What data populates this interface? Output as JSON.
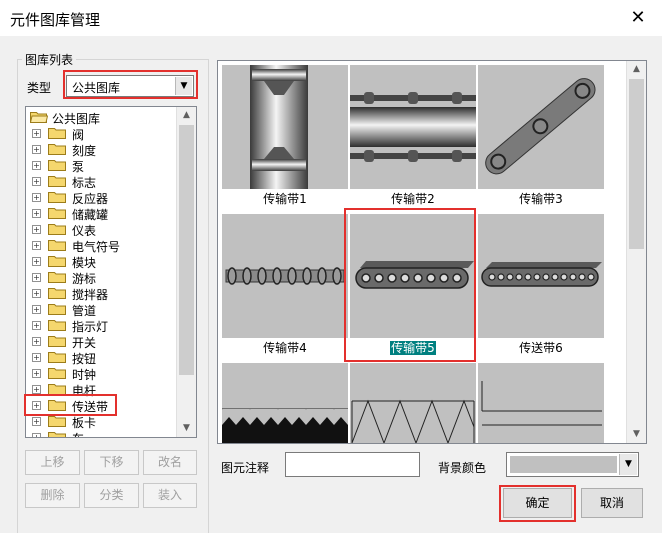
{
  "window": {
    "title": "元件图库管理",
    "close_glyph": "✕"
  },
  "library": {
    "group_caption": "图库列表",
    "type_label": "类型",
    "type_value": "公共图库",
    "tree_root": "公共图库",
    "tree_items": [
      "阀",
      "刻度",
      "泵",
      "标志",
      "反应器",
      "储藏罐",
      "仪表",
      "电气符号",
      "模块",
      "游标",
      "搅拌器",
      "管道",
      "指示灯",
      "开关",
      "按钮",
      "时钟",
      "电杆",
      "传送带",
      "板卡",
      "车"
    ]
  },
  "buttons": {
    "move_up": "上移",
    "move_down": "下移",
    "rename": "改名",
    "delete": "删除",
    "categorize": "分类",
    "load": "装入",
    "ok": "确定",
    "cancel": "取消"
  },
  "gallery": {
    "items": [
      {
        "label": "传输带1",
        "selected": false
      },
      {
        "label": "传输带2",
        "selected": false
      },
      {
        "label": "传输带3",
        "selected": false
      },
      {
        "label": "传输带4",
        "selected": false
      },
      {
        "label": "传输带5",
        "selected": true
      },
      {
        "label": "传送带6",
        "selected": false
      },
      {
        "label": "",
        "selected": false
      },
      {
        "label": "",
        "selected": false
      },
      {
        "label": "",
        "selected": false
      }
    ]
  },
  "footer": {
    "notes_label": "图元注释",
    "notes_value": "",
    "bg_label": "背景颜色",
    "bg_color": "#c0c0c0"
  },
  "colors": {
    "highlight": "#e3302d",
    "selection": "#008080",
    "tile_bg": "#c0c0c0",
    "folder": "#f5d76e"
  }
}
